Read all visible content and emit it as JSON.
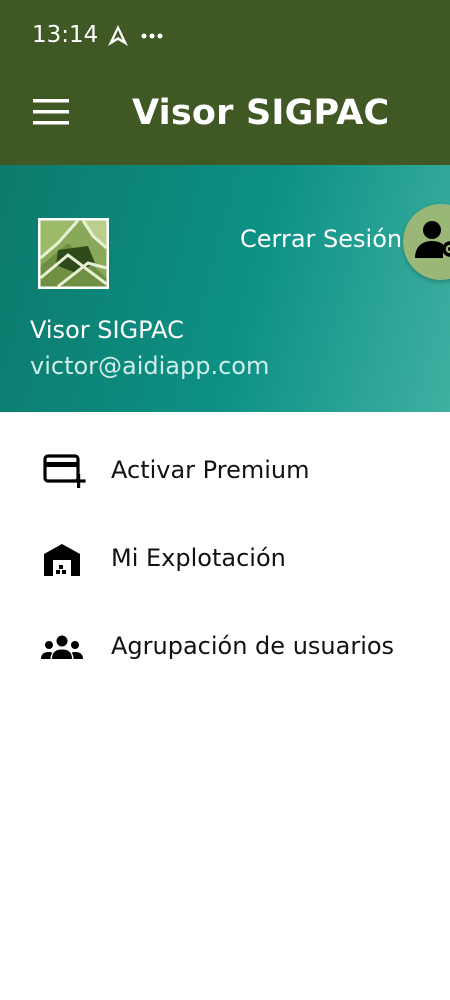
{
  "status_bar": {
    "time": "13:14",
    "icons": [
      "navigation-arrow-icon",
      "more-dots-icon"
    ]
  },
  "app_bar": {
    "title": "Visor SIGPAC",
    "menu_icon": "hamburger-menu-icon"
  },
  "drawer_header": {
    "logout_label": "Cerrar Sesión",
    "user_name": "Visor SIGPAC",
    "user_email": "victor@aidiapp.com",
    "profile_icon": "person-settings-icon"
  },
  "menu": {
    "items": [
      {
        "label": "Activar Premium",
        "icon": "credit-card-add-icon"
      },
      {
        "label": "Mi Explotación",
        "icon": "warehouse-icon"
      },
      {
        "label": "Agrupación de usuarios",
        "icon": "group-users-icon"
      }
    ]
  },
  "colors": {
    "app_bar": "#3f5824",
    "drawer_header_start": "#0c7a6c",
    "drawer_header_end": "#3fb0a2",
    "profile_fab": "#9ab778"
  }
}
